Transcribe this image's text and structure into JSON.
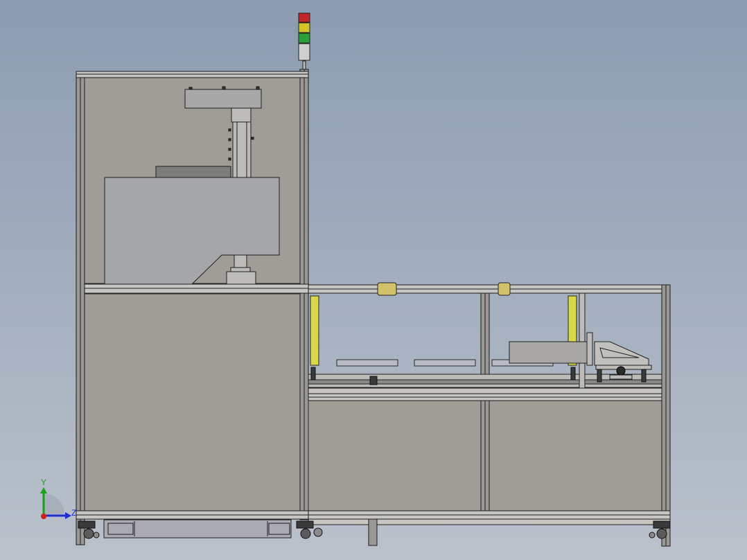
{
  "viewport": {
    "background_top": "#8c9cb1",
    "background_bottom": "#bac1cb",
    "panel_color": "#a09d97"
  },
  "stack_light": {
    "colors": [
      "#c0262a",
      "#d4c42a",
      "#2aa03a",
      "#cfcfcf"
    ]
  },
  "light_curtains": {
    "color": "#d8d84a"
  },
  "triad": {
    "y_label": "Y",
    "z_label": "Z",
    "y_color": "#1aa01a",
    "z_color": "#1d2fd0",
    "origin_color": "#d0201a"
  }
}
